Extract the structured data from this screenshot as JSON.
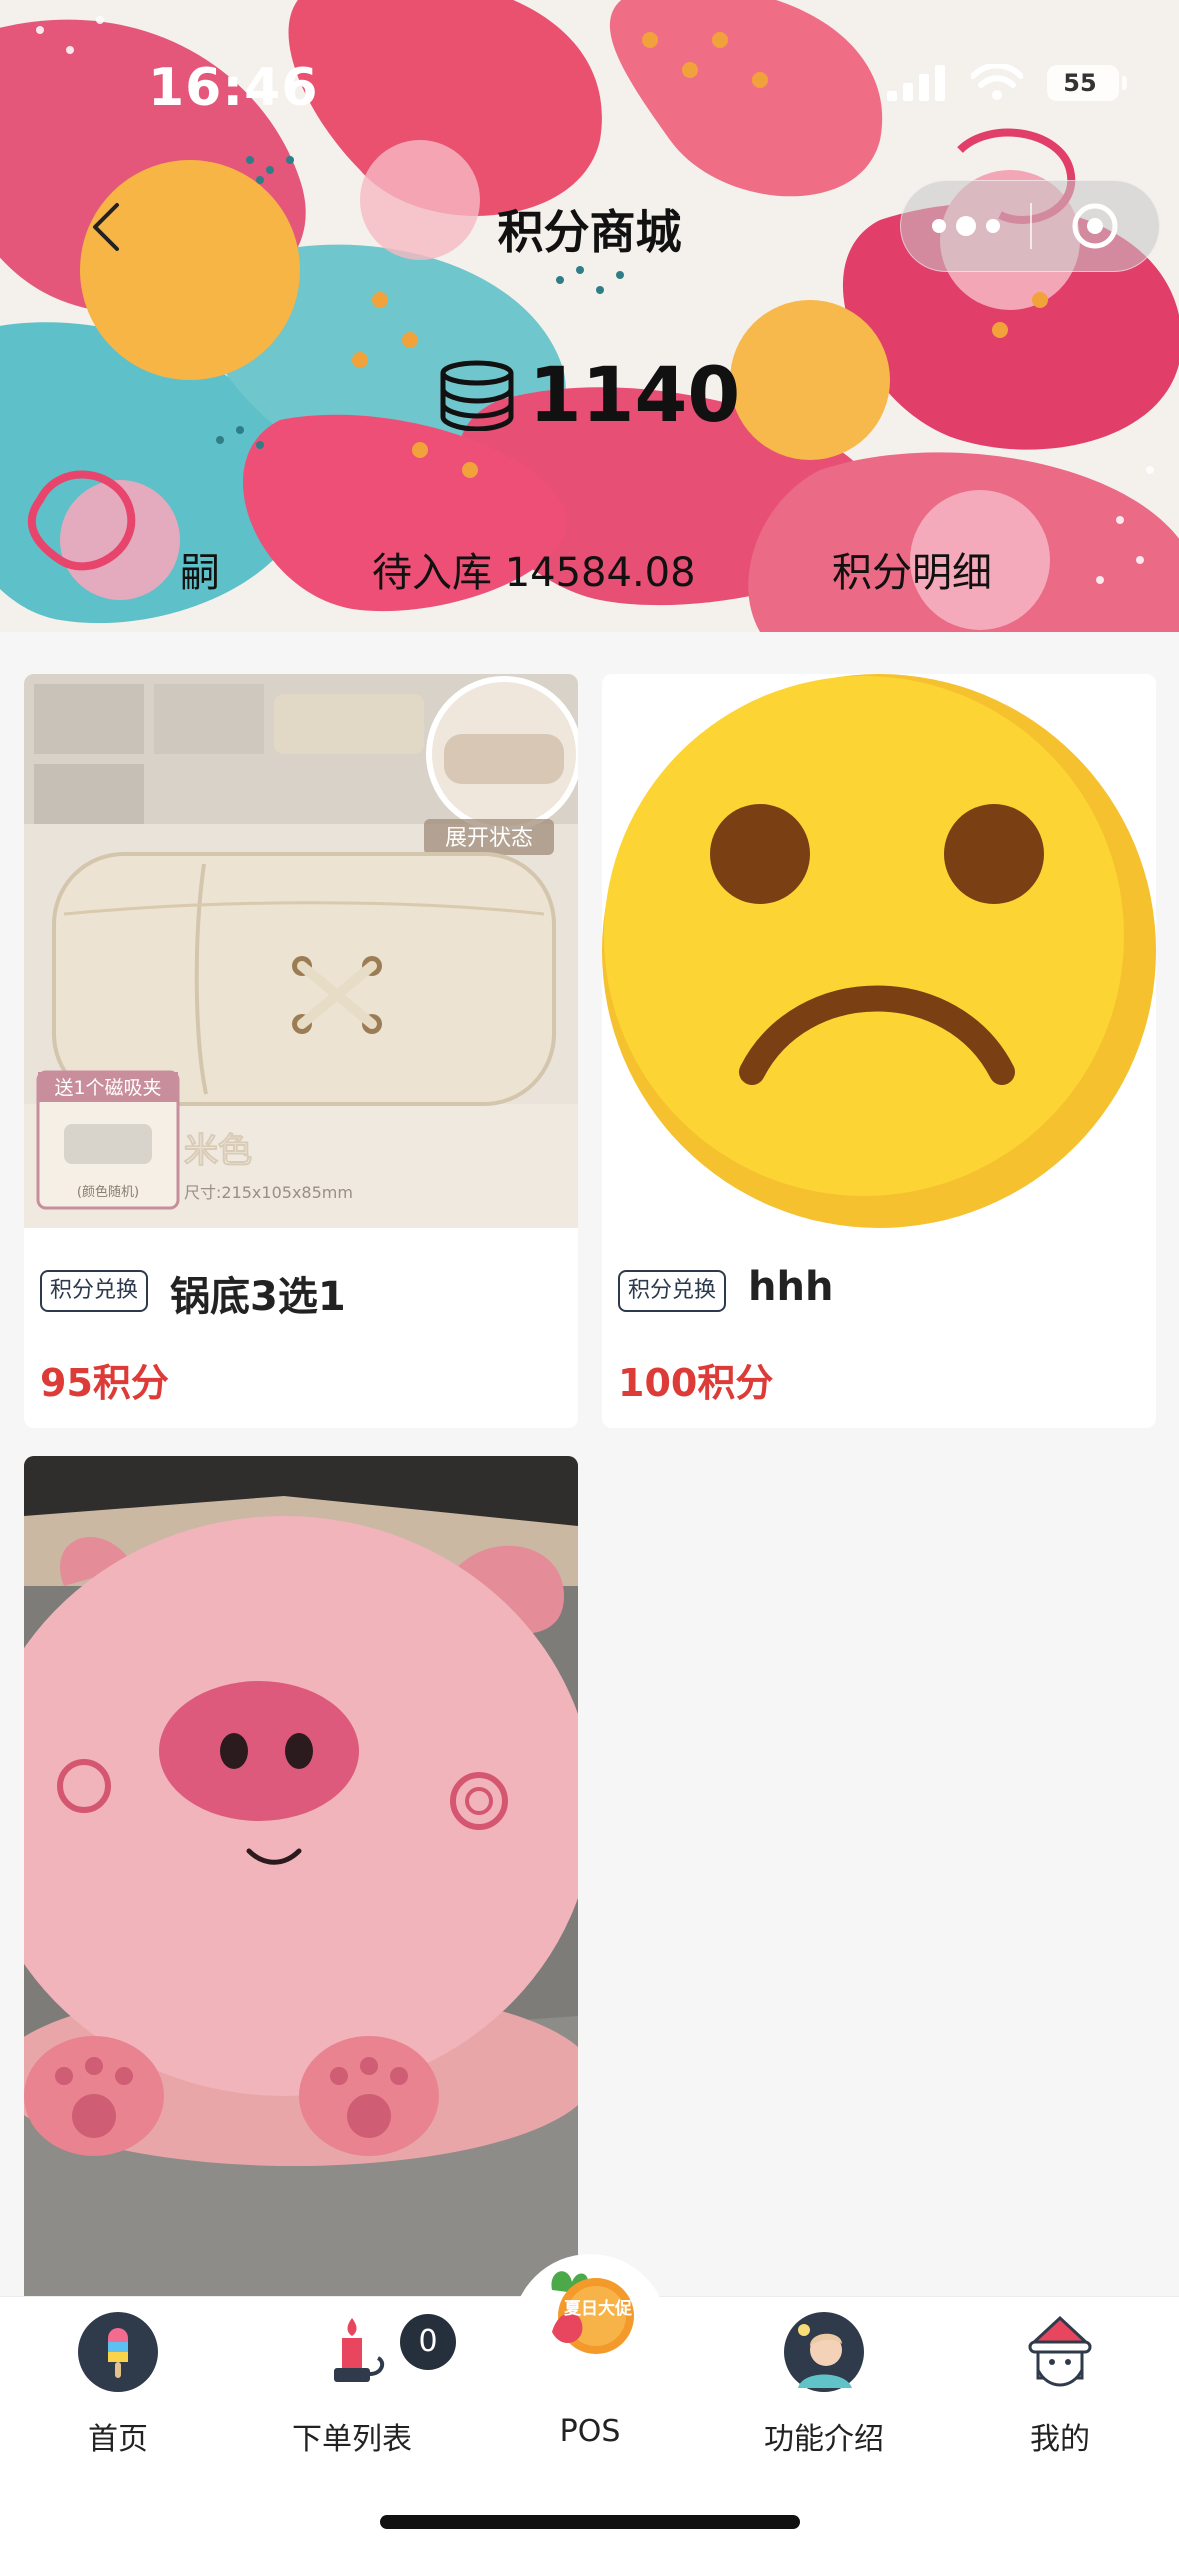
{
  "status_bar": {
    "time": "16:46",
    "battery": "55"
  },
  "header": {
    "title": "积分商城",
    "points": "1140",
    "sub_nav": [
      {
        "label": "嗣"
      },
      {
        "label": "待入库 14584.08"
      },
      {
        "label": "积分明细"
      }
    ]
  },
  "products": [
    {
      "tag": "积分兑换",
      "name": "锅底3选1",
      "price": "95积分",
      "image_text": {
        "badge": "展开状态",
        "gift": "送1个磁吸夹",
        "gift_note": "(颜色随机)",
        "color": "米色",
        "size": "尺寸:215x105x85mm"
      }
    },
    {
      "tag": "积分兑换",
      "name": "hhh",
      "price": "100积分"
    },
    {
      "tag": "",
      "name": "",
      "price": ""
    }
  ],
  "tabbar": {
    "items": [
      {
        "label": "首页"
      },
      {
        "label": "下单列表"
      },
      {
        "label": "POS",
        "promo_text": "夏日大促"
      },
      {
        "label": "功能介绍"
      },
      {
        "label": "我的"
      }
    ],
    "orders_badge": "0"
  },
  "colors": {
    "price": "#dd3b37",
    "tag_border": "#2d3a4e",
    "badge": "#26303d"
  }
}
